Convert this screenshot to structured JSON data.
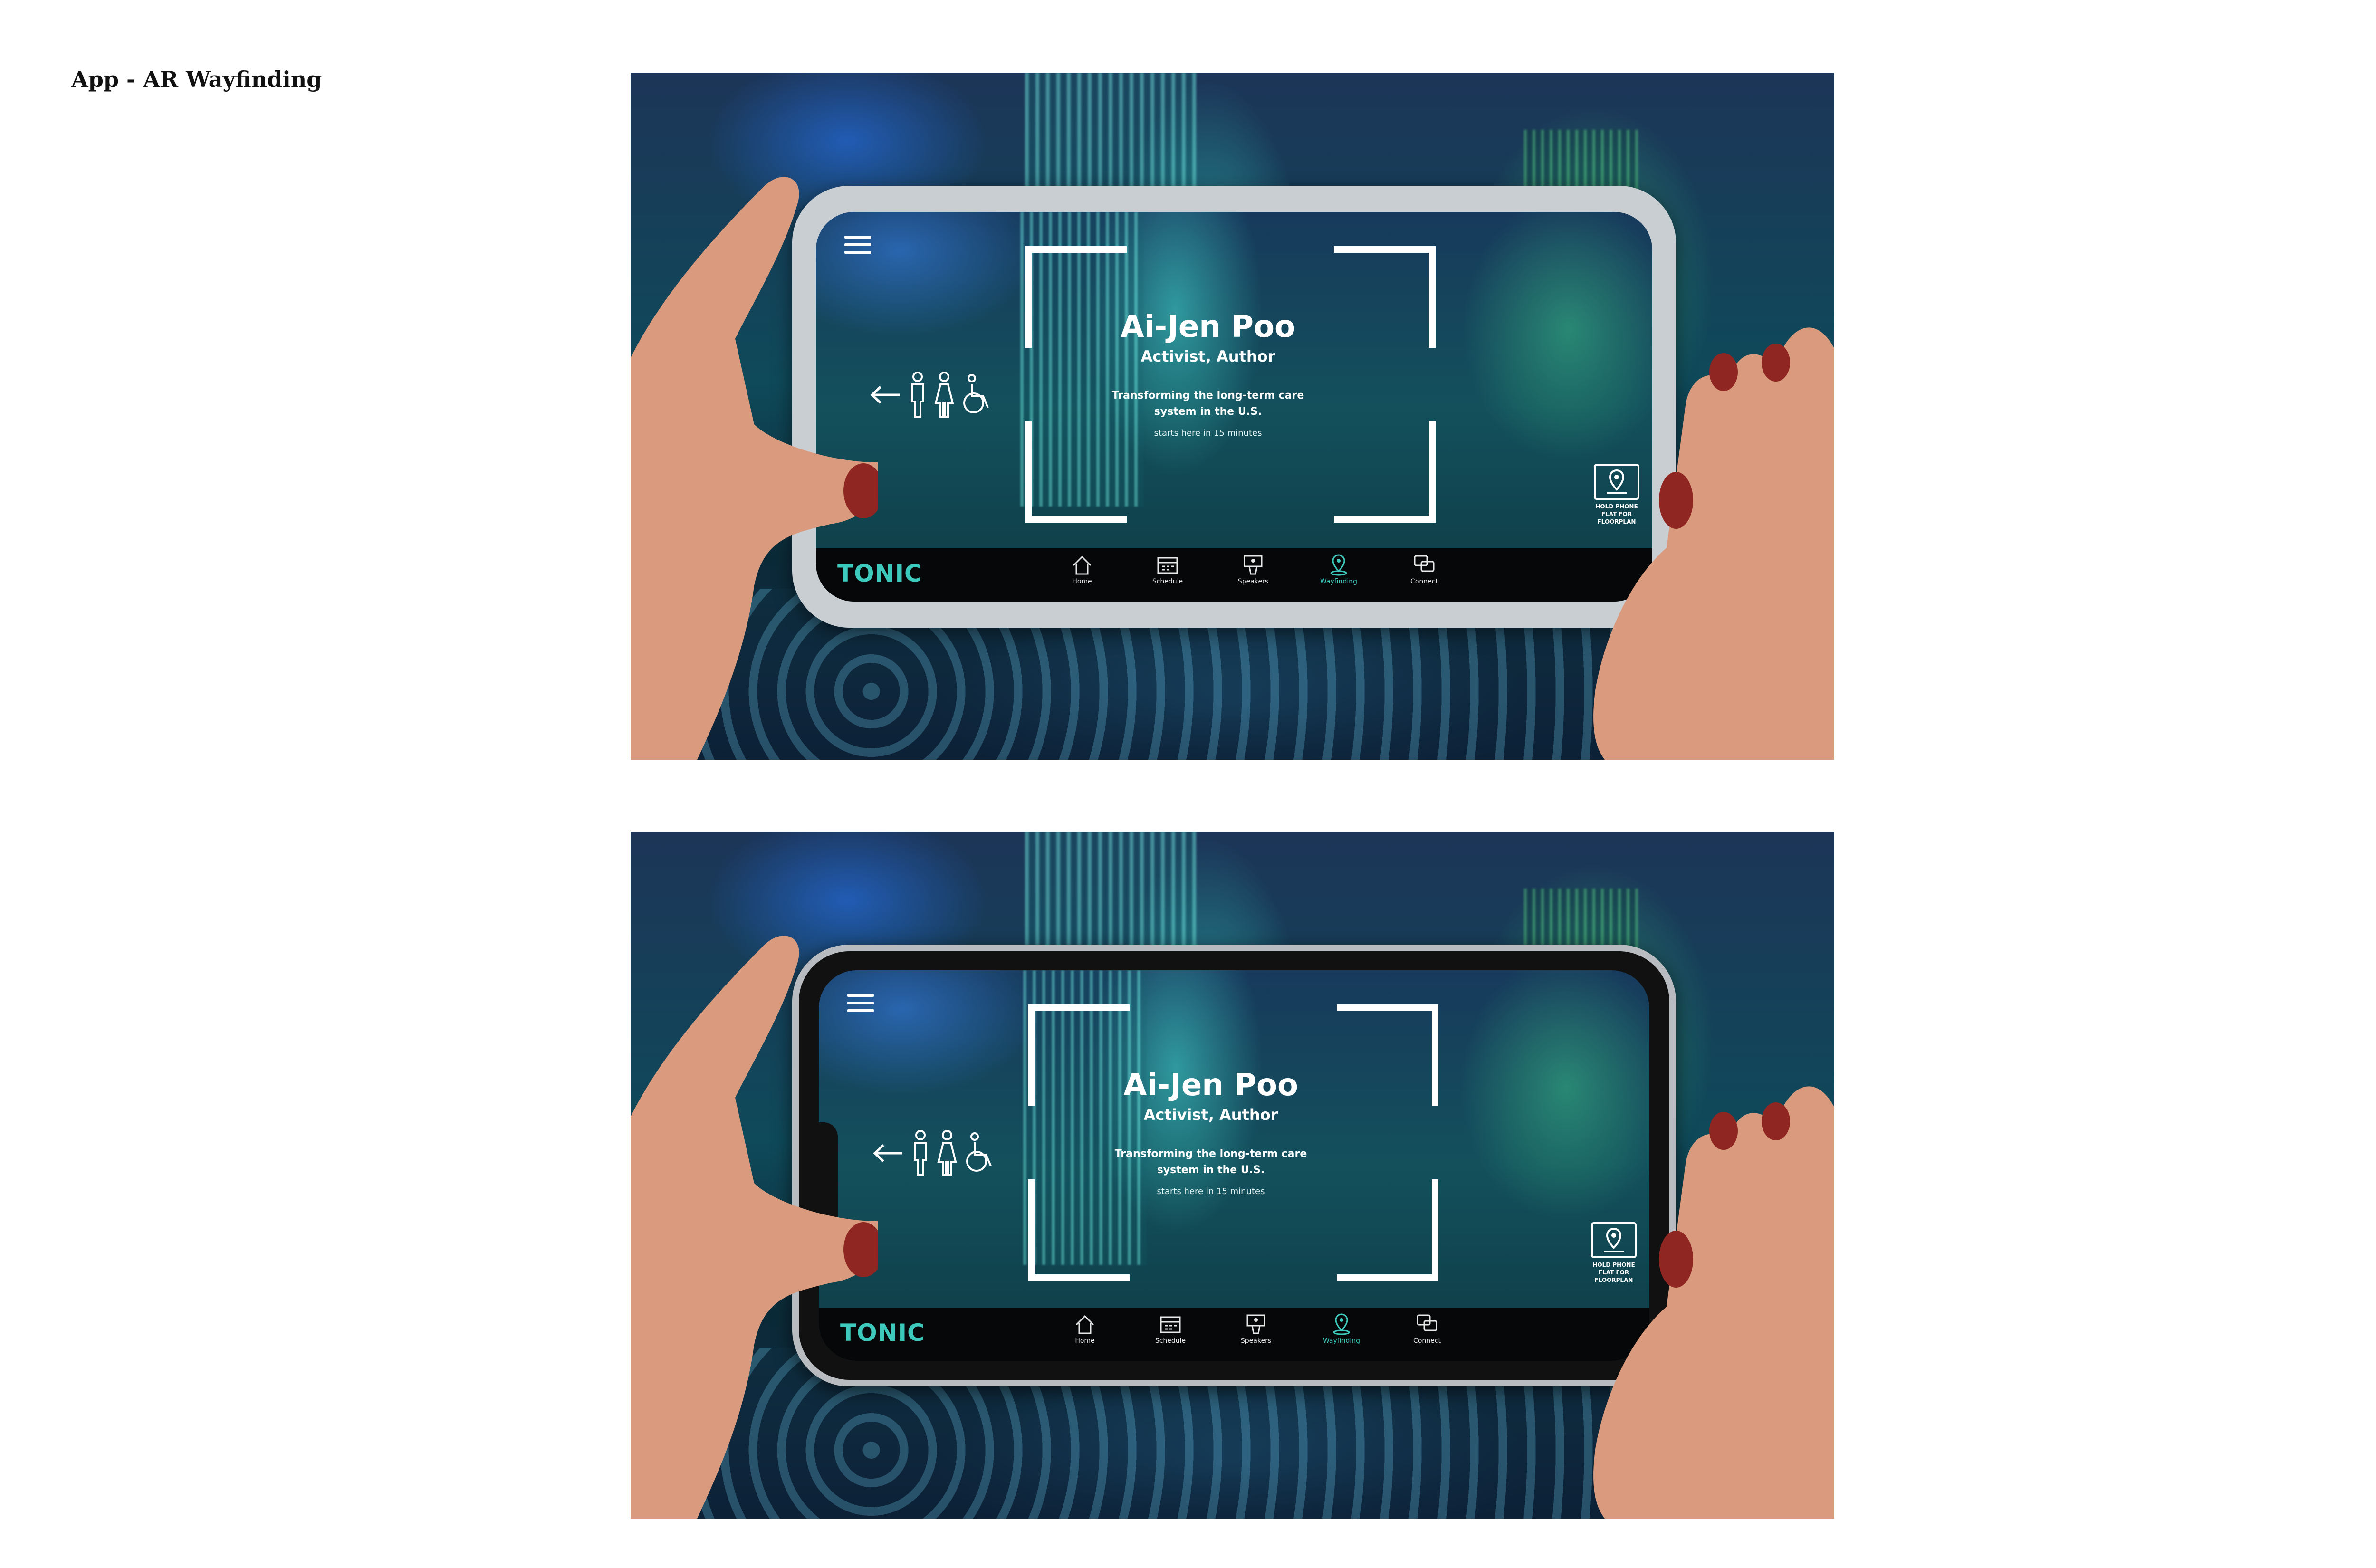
{
  "page": {
    "title": "App - AR Wayfinding"
  },
  "mockups": [
    {
      "variant": "white-frame"
    },
    {
      "variant": "black-frame"
    }
  ],
  "app": {
    "speaker": {
      "name": "Ai-Jen Poo",
      "role": "Activist, Author",
      "talk_title": "Transforming the long-term care system in the U.S.",
      "starts": "starts here in 15 minutes"
    },
    "floorplan_hint": "HOLD PHONE FLAT FOR FLOORPLAN",
    "brand": "TONIC",
    "tabs": [
      {
        "label": "Home",
        "icon": "home-icon",
        "active": false
      },
      {
        "label": "Schedule",
        "icon": "calendar-icon",
        "active": false
      },
      {
        "label": "Speakers",
        "icon": "podium-icon",
        "active": false
      },
      {
        "label": "Wayfinding",
        "icon": "location-pin-icon",
        "active": true
      },
      {
        "label": "Connect",
        "icon": "chat-icon",
        "active": false
      }
    ],
    "wayfinding_icons": [
      "arrow-left-icon",
      "man-icon",
      "woman-icon",
      "wheelchair-icon"
    ],
    "accent_color": "#3ec9bd",
    "tabbar_color": "#050708"
  }
}
